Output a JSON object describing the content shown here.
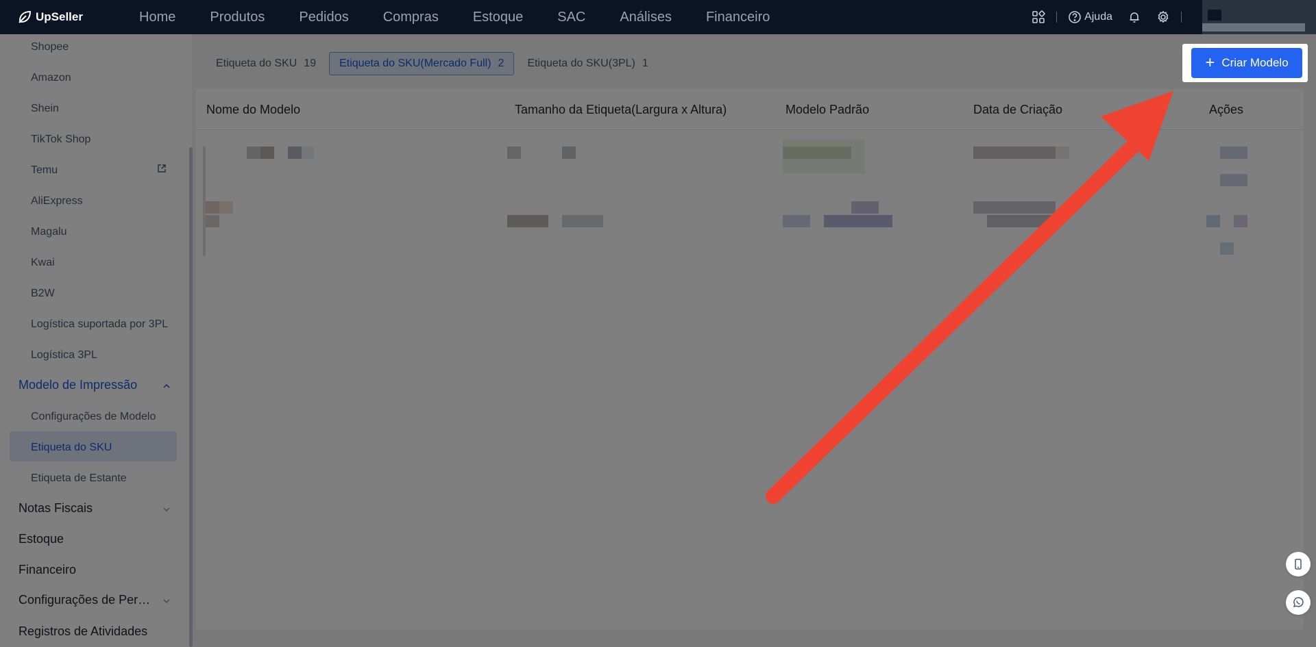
{
  "brand": {
    "name": "UpSeller"
  },
  "nav": [
    "Home",
    "Produtos",
    "Pedidos",
    "Compras",
    "Estoque",
    "SAC",
    "Análises",
    "Financeiro"
  ],
  "top_right": {
    "help_label": "Ajuda"
  },
  "sidebar": {
    "sub_items_top": [
      "Shopee",
      "Amazon",
      "Shein",
      "TikTok Shop",
      "Temu",
      "AliExpress",
      "Magalu",
      "Kwai",
      "B2W",
      "Logística suportada por 3PL",
      "Logística 3PL"
    ],
    "print_group": "Modelo de Impressão",
    "print_items": [
      "Configurações de Modelo",
      "Etiqueta do SKU",
      "Etiqueta de Estante"
    ],
    "groups_bottom": [
      "Notas Fiscais",
      "Estoque",
      "Financeiro",
      "Configurações de Per…",
      "Registros de Atividades"
    ]
  },
  "tabs": [
    {
      "label": "Etiqueta do SKU",
      "count": "19"
    },
    {
      "label": "Etiqueta do SKU(Mercado Full)",
      "count": "2"
    },
    {
      "label": "Etiqueta do SKU(3PL)",
      "count": "1"
    }
  ],
  "create_button": {
    "label": "Criar Modelo"
  },
  "table": {
    "columns": [
      "Nome do Modelo",
      "Tamanho da Etiqueta(Largura x Altura)",
      "Modelo Padrão",
      "Data de Criação",
      "Ações"
    ]
  },
  "colors": {
    "accent": "#2363f0",
    "arrow": "#ef4230",
    "topbar": "#0b1424"
  },
  "icons": [
    "apps-icon",
    "help-icon",
    "bell-icon",
    "gear-icon",
    "external-link-icon",
    "phone-icon",
    "whatsapp-icon"
  ]
}
